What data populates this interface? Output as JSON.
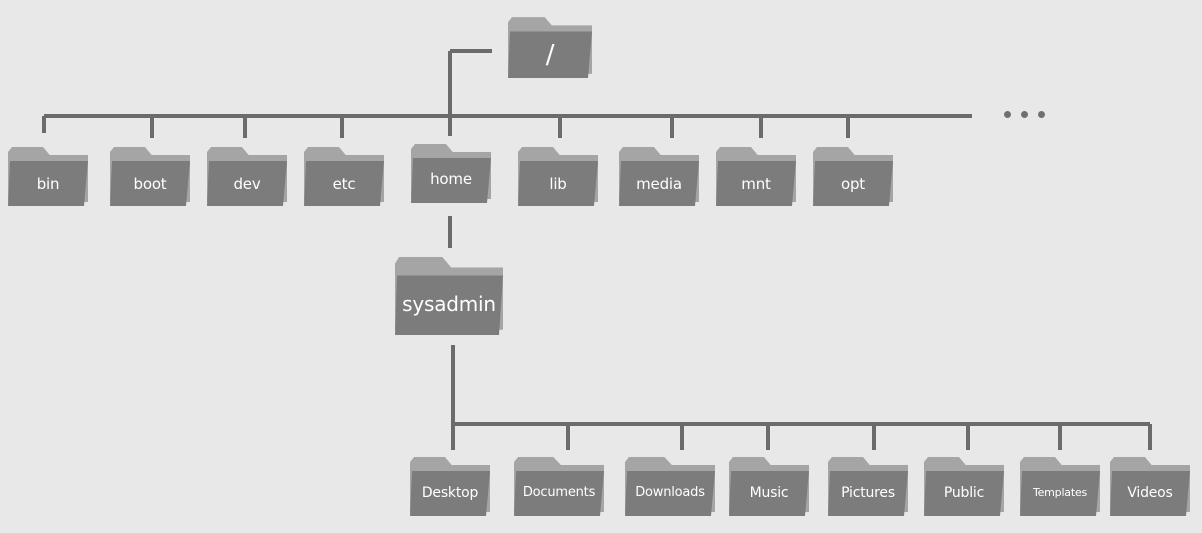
{
  "colors": {
    "background": "#e8e8e8",
    "line": "#6b6b6b",
    "folder_back": "#a5a5a5",
    "folder_front": "#7c7c7c",
    "label": "#ffffff"
  },
  "root": {
    "label": "/",
    "icon": "folder-icon"
  },
  "level1": [
    {
      "label": "bin"
    },
    {
      "label": "boot"
    },
    {
      "label": "dev"
    },
    {
      "label": "etc"
    },
    {
      "label": "home"
    },
    {
      "label": "lib"
    },
    {
      "label": "media"
    },
    {
      "label": "mnt"
    },
    {
      "label": "opt"
    }
  ],
  "more_indicator": "ellipsis",
  "user_dir": {
    "label": "sysadmin"
  },
  "user_subdirs": [
    {
      "label": "Desktop"
    },
    {
      "label": "Documents"
    },
    {
      "label": "Downloads"
    },
    {
      "label": "Music"
    },
    {
      "label": "Pictures"
    },
    {
      "label": "Public"
    },
    {
      "label": "Templates"
    },
    {
      "label": "Videos"
    }
  ]
}
